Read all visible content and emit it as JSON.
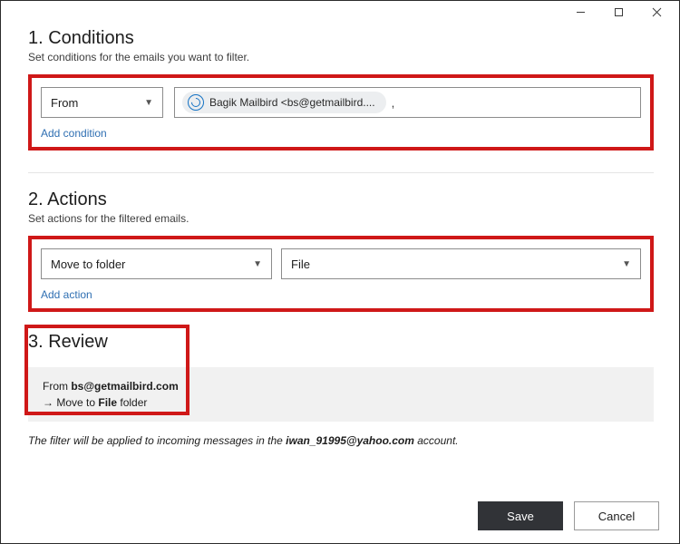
{
  "conditions": {
    "title": "1. Conditions",
    "subtitle": "Set conditions for the emails you want to filter.",
    "field_select": "From",
    "contact_chip": "Bagik Mailbird  <bs@getmailbird....",
    "chip_separator": ",",
    "add_link": "Add condition"
  },
  "actions": {
    "title": "2. Actions",
    "subtitle": "Set actions for the filtered emails.",
    "action_select": "Move to folder",
    "folder_select": "File",
    "add_link": "Add action"
  },
  "review": {
    "title": "3. Review",
    "from_prefix": "From ",
    "from_value": "bs@getmailbird.com",
    "arrow": "→  Move to ",
    "folder_value": "File",
    "folder_suffix": " folder"
  },
  "footnote": {
    "prefix": "The filter will be applied to incoming messages in the ",
    "account": "iwan_91995@yahoo.com",
    "suffix": " account."
  },
  "buttons": {
    "save": "Save",
    "cancel": "Cancel"
  }
}
